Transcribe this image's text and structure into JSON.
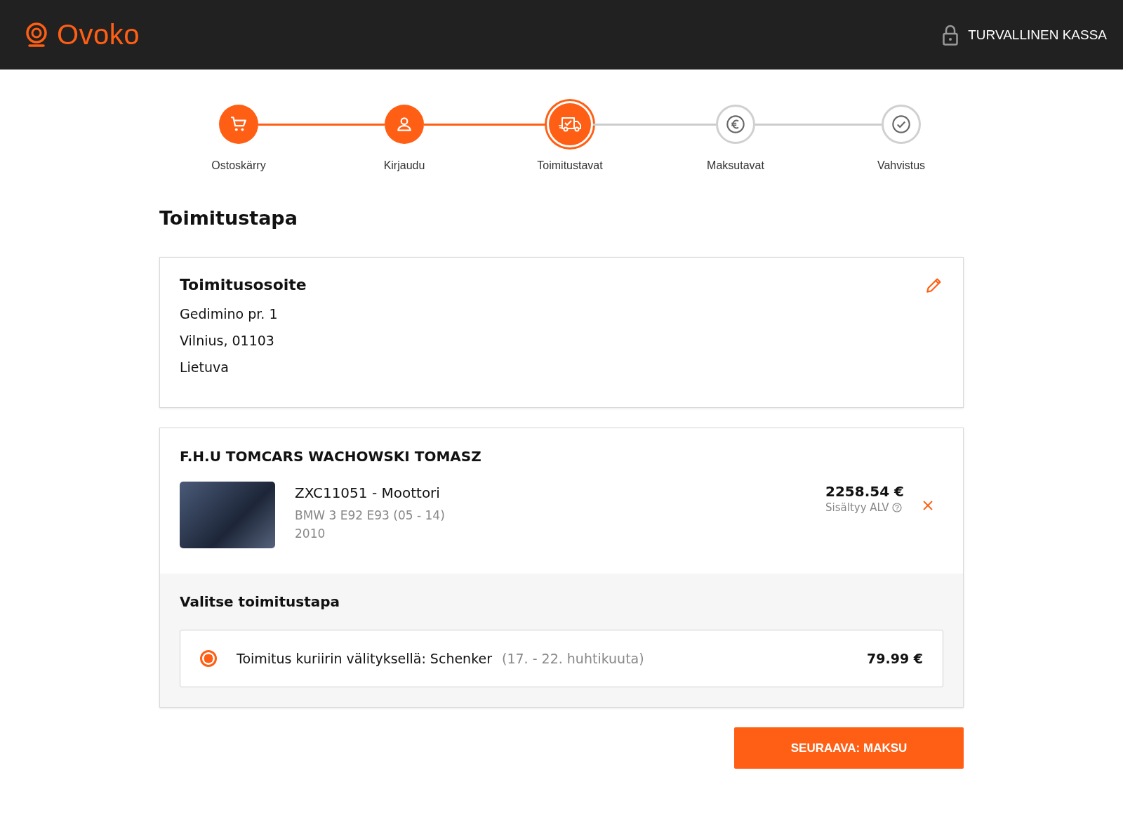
{
  "header": {
    "logo": "Ovoko",
    "secure_label": "TURVALLINEN KASSA"
  },
  "steps": [
    {
      "label": "Ostoskärry",
      "kind": "done"
    },
    {
      "label": "Kirjaudu",
      "kind": "done"
    },
    {
      "label": "Toimitustavat",
      "kind": "current"
    },
    {
      "label": "Maksutavat",
      "kind": "upcoming"
    },
    {
      "label": "Vahvistus",
      "kind": "upcoming"
    }
  ],
  "page_title": "Toimitustapa",
  "address_card": {
    "title": "Toimitusosoite",
    "lines": [
      "Gedimino pr. 1",
      "Vilnius, 01103",
      "Lietuva"
    ]
  },
  "seller_card": {
    "seller": "F.H.U TOMCARS WACHOWSKI TOMASZ",
    "item": {
      "title": "ZXC11051 - Moottori",
      "model": "BMW 3 E92 E93 (05 - 14)",
      "year": "2010",
      "price": "2258.54 €",
      "vat_note": "Sisältyy ALV"
    },
    "delivery_title": "Valitse toimitustapa",
    "options": [
      {
        "label": "Toimitus kuriirin välityksellä: Schenker",
        "dates": "(17. - 22. huhtikuuta)",
        "price": "79.99 €",
        "selected": true
      }
    ]
  },
  "next_button": "SEURAAVA: MAKSU"
}
